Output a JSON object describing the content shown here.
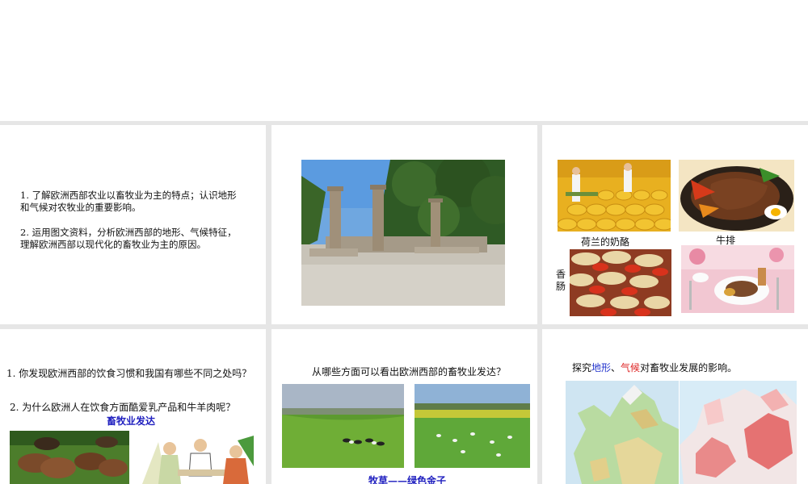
{
  "slide1": {
    "goal1_line1": "1. 了解欧洲西部农业以畜牧业为主的特点；认识地形",
    "goal1_line2": "和气候对农牧业的重要影响。",
    "goal2_line1": "2. 运用图文资料，分析欧洲西部的地形、气候特征，",
    "goal2_line2": "理解欧洲西部以现代化的畜牧业为主的原因。"
  },
  "slide3": {
    "cheese_caption": "荷兰的奶酪",
    "steak_caption": "牛排",
    "sausage_caption_1": "香",
    "sausage_caption_2": "肠"
  },
  "slide4": {
    "question1": "1. 你发现欧洲西部的饮食习惯和我国有哪些不同之处吗？",
    "question2": "2. 为什么欧洲人在饮食方面酷爱乳产品和牛羊肉呢？",
    "answer": "畜牧业发达"
  },
  "slide5": {
    "question": "从哪些方面可以看出欧洲西部的畜牧业发达？",
    "bottom_caption": "牧草——绿色金子"
  },
  "slide6": {
    "prefix": "探究",
    "terrain": "地形",
    "sep": "、",
    "climate": "气候",
    "suffix": "对畜牧业发展的影响。"
  },
  "colors": {
    "accent_blue": "#1f1fbf",
    "accent_red": "#dd2222",
    "divider": "#e6e6e6"
  }
}
